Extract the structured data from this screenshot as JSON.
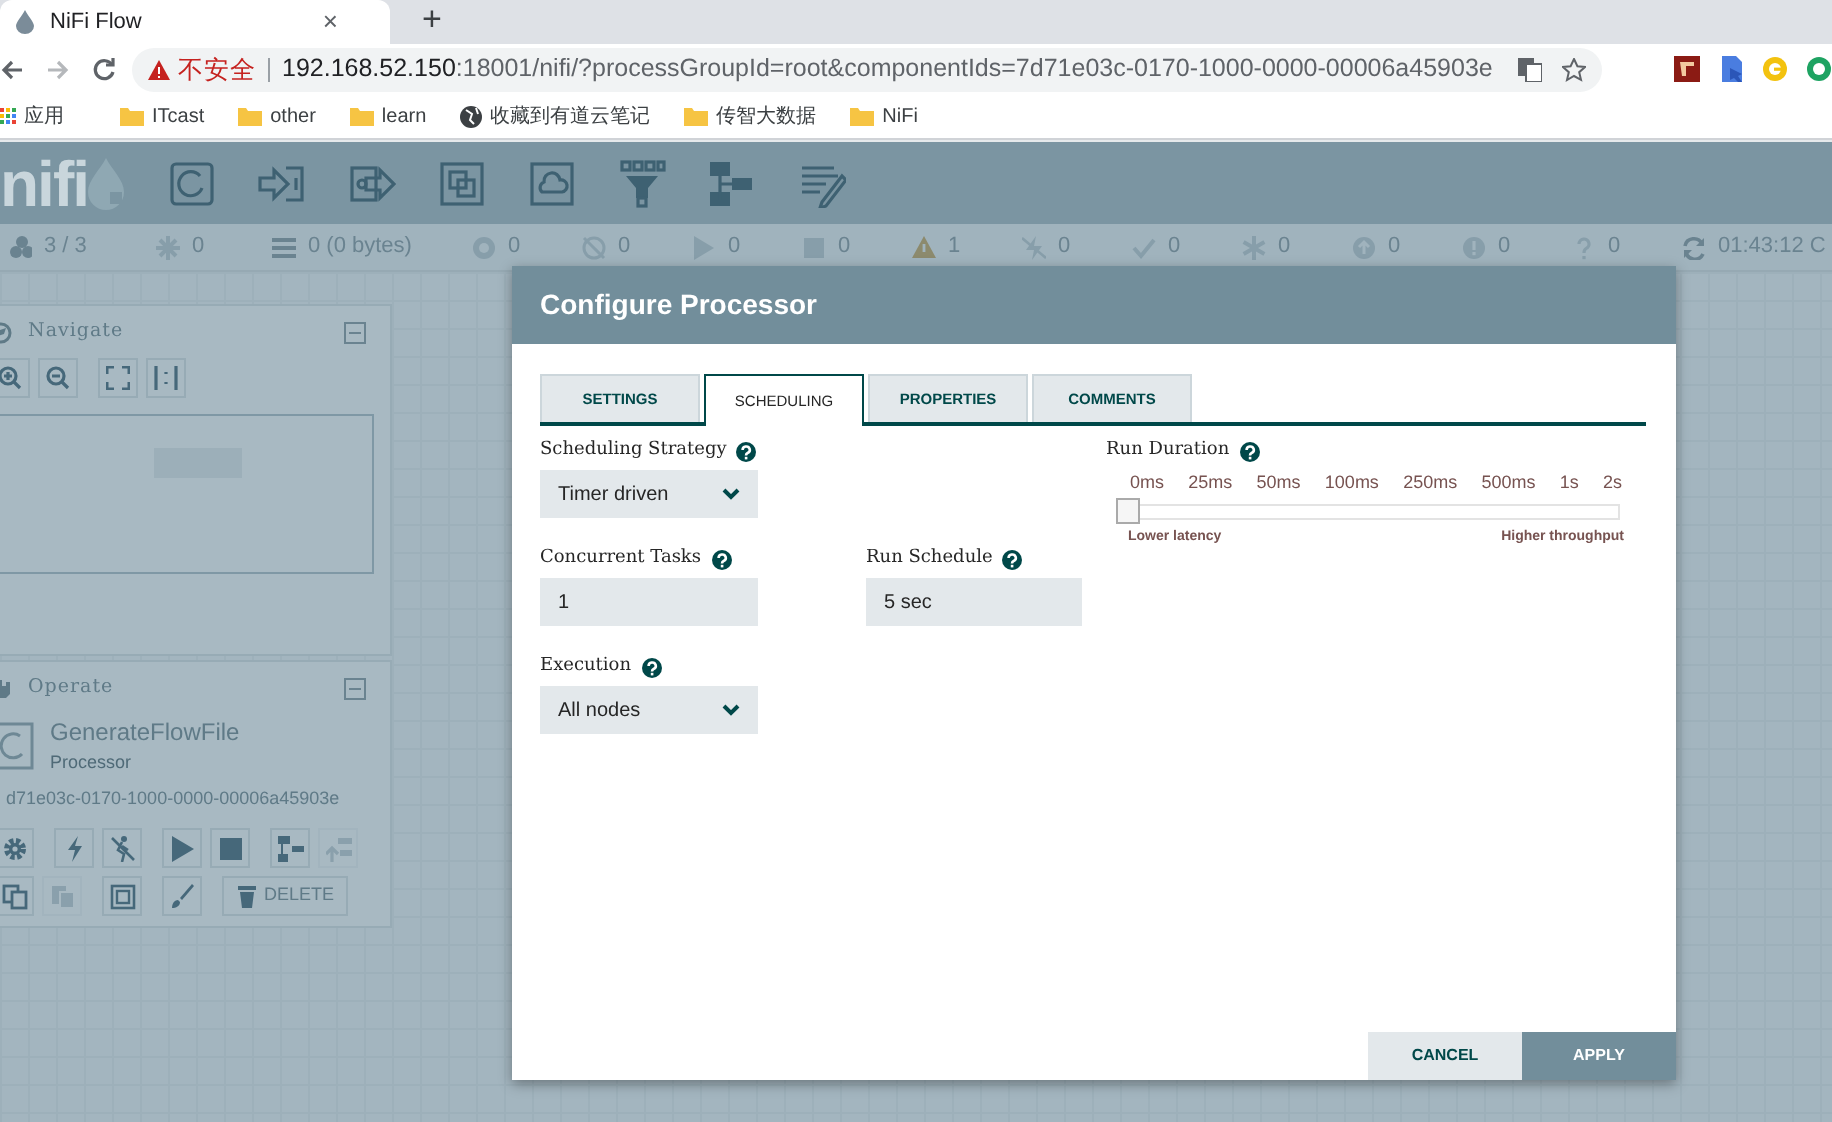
{
  "browser": {
    "tab_title": "NiFi Flow",
    "tab_close": "×",
    "new_tab": "+",
    "address": {
      "security_label": "不安全",
      "host": "192.168.52.150",
      "path": ":18001/nifi/?processGroupId=root&componentIds=7d71e03c-0170-1000-0000-00006a45903e"
    },
    "bookmarks": [
      {
        "kind": "apps",
        "label": "应用"
      },
      {
        "kind": "folder",
        "label": "ITcast"
      },
      {
        "kind": "folder",
        "label": "other"
      },
      {
        "kind": "folder",
        "label": "learn"
      },
      {
        "kind": "globe",
        "label": "收藏到有道云笔记"
      },
      {
        "kind": "folder",
        "label": "传智大数据"
      },
      {
        "kind": "folder",
        "label": "NiFi"
      }
    ]
  },
  "header": {
    "logo": "nifi"
  },
  "status_bar": [
    {
      "kind": "nodes",
      "text": "3 / 3"
    },
    {
      "kind": "cluster",
      "text": "0"
    },
    {
      "kind": "queue",
      "text": "0 (0 bytes)"
    },
    {
      "kind": "transmitting",
      "text": "0"
    },
    {
      "kind": "not-transmitting",
      "text": "0"
    },
    {
      "kind": "running",
      "text": "0"
    },
    {
      "kind": "stopped",
      "text": "0"
    },
    {
      "kind": "invalid",
      "text": "1"
    },
    {
      "kind": "disabled",
      "text": "0"
    },
    {
      "kind": "up-to-date",
      "text": "0"
    },
    {
      "kind": "modified",
      "text": "0"
    },
    {
      "kind": "stale",
      "text": "0"
    },
    {
      "kind": "stale-modified",
      "text": "0"
    },
    {
      "kind": "sync-failure",
      "text": "0"
    },
    {
      "kind": "refresh",
      "text": "01:43:12 C"
    }
  ],
  "navigate": {
    "title": "Navigate"
  },
  "operate": {
    "title": "Operate",
    "component_name": "GenerateFlowFile",
    "component_type": "Processor",
    "component_id": "d71e03c-0170-1000-0000-00006a45903e",
    "row_1": [
      {
        "kind": "configure",
        "disabled": false
      },
      {
        "kind": "enable",
        "disabled": false
      },
      {
        "kind": "disable",
        "disabled": false
      },
      {
        "kind": "start",
        "disabled": false
      },
      {
        "kind": "stop",
        "disabled": false
      },
      {
        "kind": "template",
        "disabled": false
      },
      {
        "kind": "upload",
        "disabled": true
      }
    ],
    "row_2": [
      {
        "kind": "copy",
        "disabled": false
      },
      {
        "kind": "paste",
        "disabled": true
      },
      {
        "kind": "group",
        "disabled": false
      },
      {
        "kind": "color",
        "disabled": false
      },
      {
        "kind": "delete",
        "disabled": false,
        "label": "DELETE"
      }
    ]
  },
  "dialog": {
    "title": "Configure Processor",
    "tabs": [
      {
        "label": "SETTINGS",
        "selected": false
      },
      {
        "label": "SCHEDULING",
        "selected": true
      },
      {
        "label": "PROPERTIES",
        "selected": false
      },
      {
        "label": "COMMENTS",
        "selected": false
      }
    ],
    "fields": [
      {
        "kind": "select",
        "label": "Scheduling Strategy",
        "value": "Timer driven"
      },
      {
        "kind": "input",
        "label": "Concurrent Tasks",
        "value": "1"
      },
      {
        "kind": "input",
        "label": "Run Schedule",
        "value": "5 sec"
      },
      {
        "kind": "select",
        "label": "Execution",
        "value": "All nodes"
      }
    ],
    "run_duration": {
      "label": "Run Duration",
      "ticks": [
        "0ms",
        "25ms",
        "50ms",
        "100ms",
        "250ms",
        "500ms",
        "1s",
        "2s"
      ],
      "level": 0,
      "low_label": "Lower latency",
      "high_label": "Higher throughput"
    },
    "buttons": [
      {
        "kind": "secondary",
        "label": "CANCEL"
      },
      {
        "kind": "primary",
        "label": "APPLY"
      }
    ]
  }
}
